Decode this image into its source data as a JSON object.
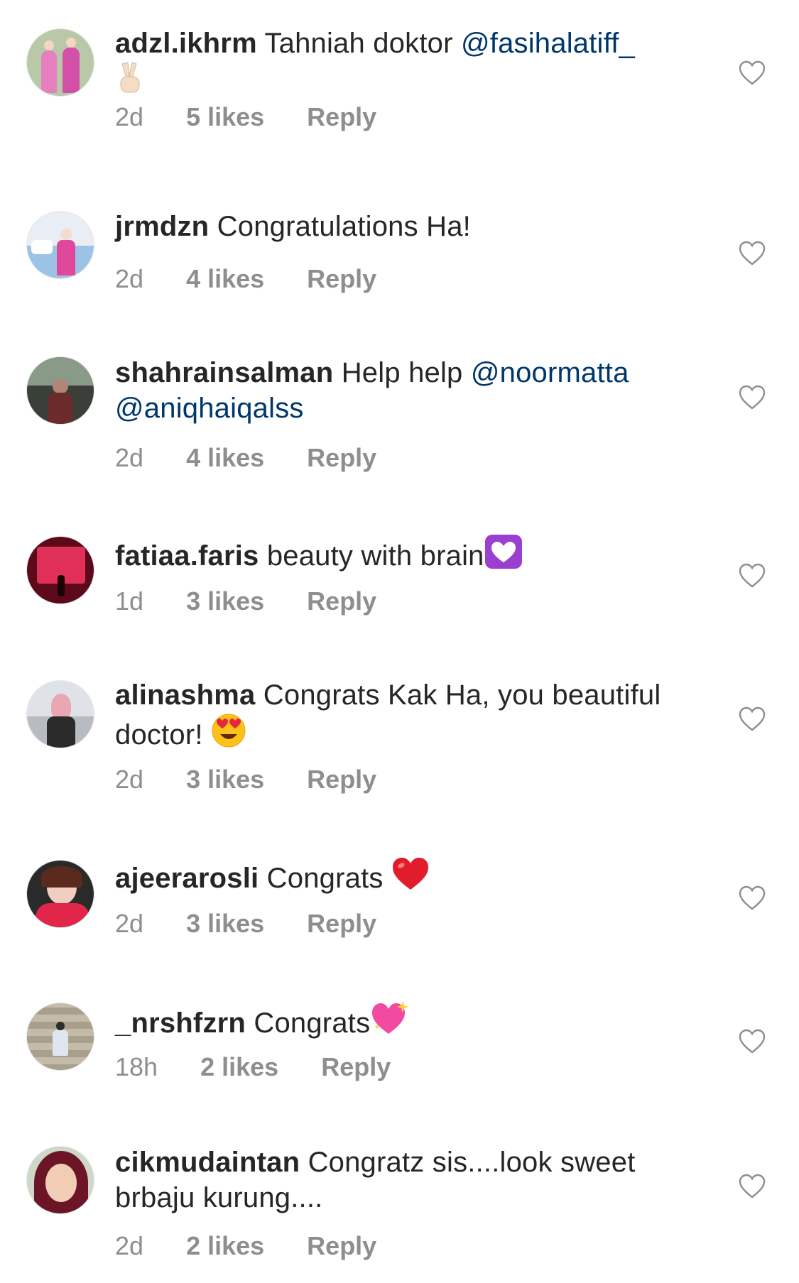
{
  "comments": [
    {
      "username": "adzl.ikhrm",
      "text": "Tahniah doktor ",
      "mention": "@fasihalatiff_",
      "emoji": "victory-hand",
      "time": "2d",
      "likes": "5 likes",
      "reply": "Reply"
    },
    {
      "username": "jrmdzn",
      "text": "Congratulations Ha!",
      "time": "2d",
      "likes": "4 likes",
      "reply": "Reply"
    },
    {
      "username": "shahrainsalman",
      "text": "Help help ",
      "mention": "@noormatta",
      "mention2": "@aniqhaiqalss",
      "time": "2d",
      "likes": "4 likes",
      "reply": "Reply"
    },
    {
      "username": "fatiaa.faris",
      "text": "beauty with brain",
      "emoji": "white-heart-purple-square",
      "time": "1d",
      "likes": "3 likes",
      "reply": "Reply"
    },
    {
      "username": "alinashma",
      "text": "Congrats Kak Ha, you beautiful doctor! ",
      "emoji": "heart-eyes-face",
      "time": "2d",
      "likes": "3 likes",
      "reply": "Reply"
    },
    {
      "username": "ajeerarosli",
      "text": "Congrats ",
      "emoji": "red-heart",
      "time": "2d",
      "likes": "3 likes",
      "reply": "Reply"
    },
    {
      "username": "_nrshfzrn",
      "text": "Congrats",
      "emoji": "sparkling-heart",
      "time": "18h",
      "likes": "2 likes",
      "reply": "Reply"
    },
    {
      "username": "cikmudaintan",
      "text": "Congratz sis....look sweet brbaju kurung....",
      "time": "2d",
      "likes": "2 likes",
      "reply": "Reply"
    }
  ],
  "colors": {
    "text": "#262626",
    "mention": "#00376b",
    "meta": "#8e8e8e",
    "heart_outline": "#8e8e8e"
  }
}
